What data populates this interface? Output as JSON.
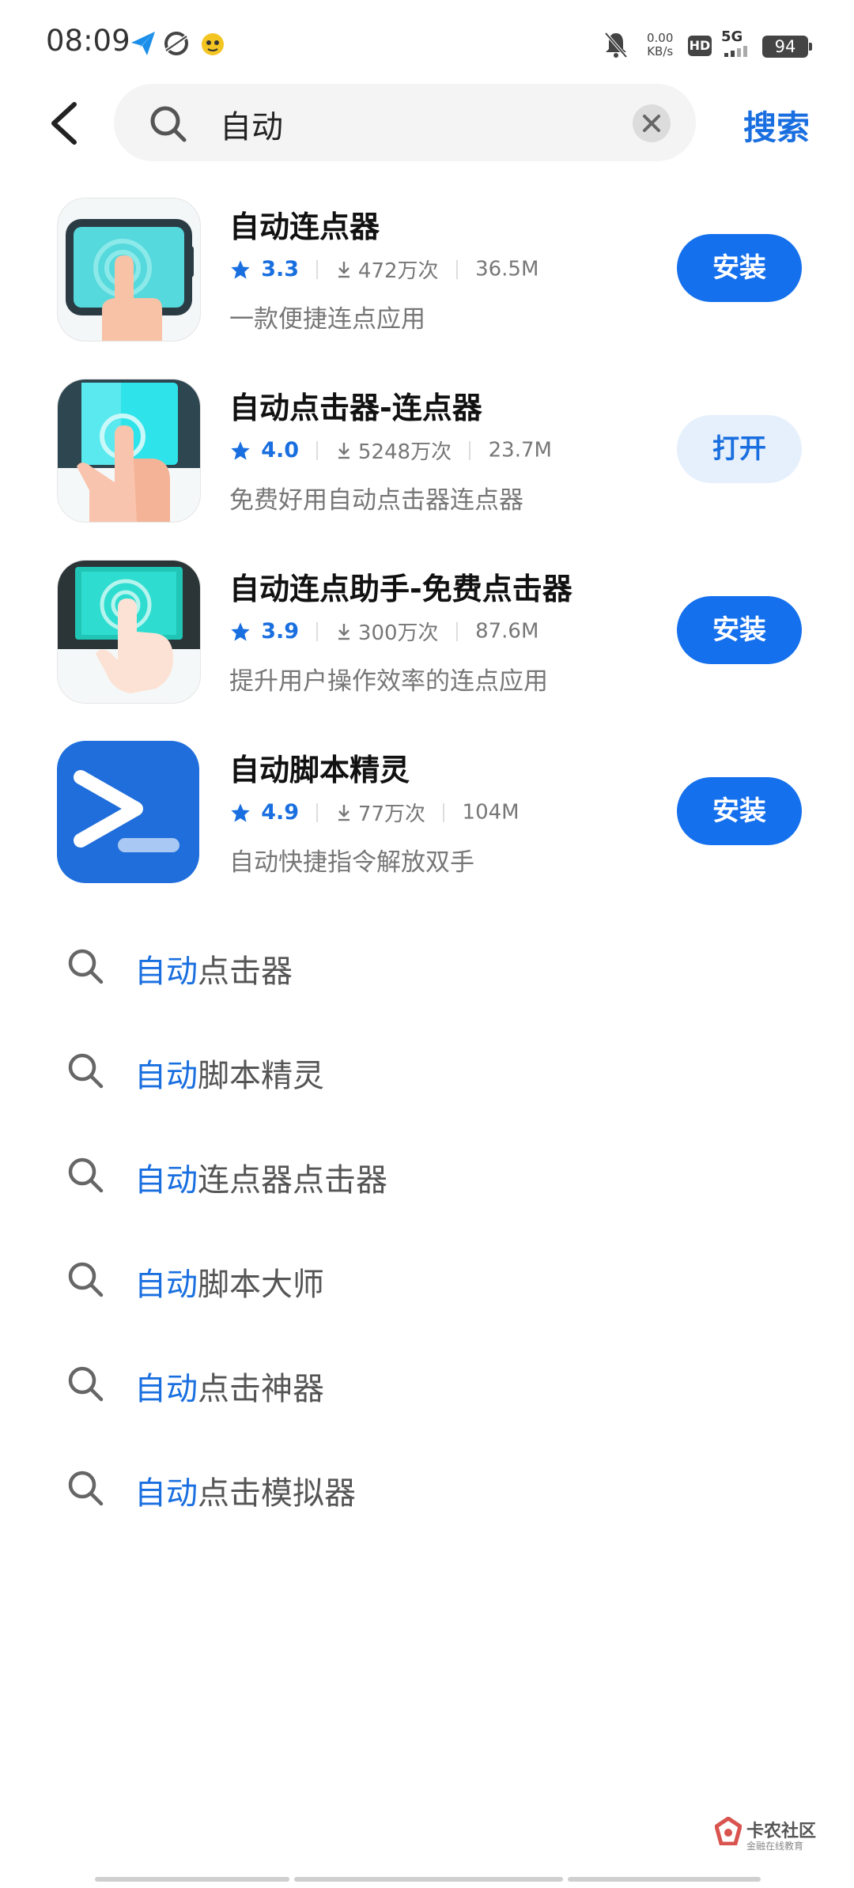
{
  "status_bar": {
    "time": "08:09",
    "net_speed_value": "0.00",
    "net_speed_unit": "KB/s",
    "hd_label": "HD",
    "network_label": "5G",
    "battery": "94"
  },
  "search": {
    "query": "自动",
    "action_label": "搜索"
  },
  "apps": [
    {
      "name": "自动连点器",
      "rating": "3.3",
      "downloads": "472万次",
      "size": "36.5M",
      "desc": "一款便捷连点应用",
      "button": "安装"
    },
    {
      "name": "自动点击器-连点器",
      "rating": "4.0",
      "downloads": "5248万次",
      "size": "23.7M",
      "desc": "免费好用自动点击器连点器",
      "button": "打开"
    },
    {
      "name": "自动连点助手-免费点击器",
      "rating": "3.9",
      "downloads": "300万次",
      "size": "87.6M",
      "desc": "提升用户操作效率的连点应用",
      "button": "安装"
    },
    {
      "name": "自动脚本精灵",
      "rating": "4.9",
      "downloads": "77万次",
      "size": "104M",
      "desc": "自动快捷指令解放双手",
      "button": "安装"
    }
  ],
  "suggestions": [
    {
      "highlight": "自动",
      "rest": "点击器"
    },
    {
      "highlight": "自动",
      "rest": "脚本精灵"
    },
    {
      "highlight": "自动",
      "rest": "连点器点击器"
    },
    {
      "highlight": "自动",
      "rest": "脚本大师"
    },
    {
      "highlight": "自动",
      "rest": "点击神器"
    },
    {
      "highlight": "自动",
      "rest": "点击模拟器"
    }
  ],
  "watermark": {
    "title": "卡农社区",
    "subtitle": "金融在线教育"
  },
  "colors": {
    "accent": "#1a6fe0",
    "install_button": "#1570ee",
    "open_button_bg": "#e6f0fc"
  }
}
